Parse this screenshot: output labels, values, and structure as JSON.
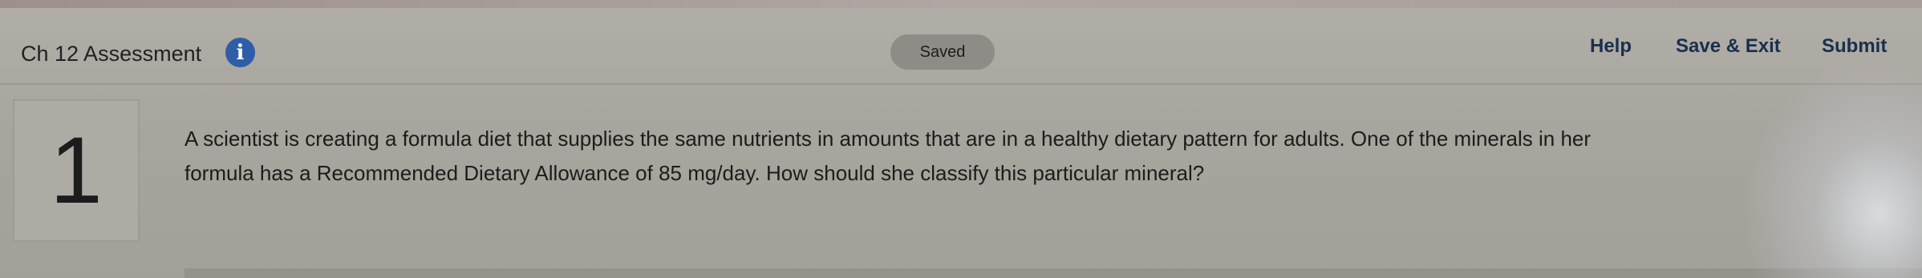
{
  "header": {
    "title": "Ch 12 Assessment",
    "info_icon": "info-icon",
    "status": "Saved",
    "nav": {
      "help": "Help",
      "save_exit": "Save & Exit",
      "submit": "Submit"
    }
  },
  "question": {
    "number": "1",
    "line1": "A scientist is creating a formula diet that supplies the same nutrients in amounts that are in a healthy dietary pattern for adults. One of the minerals in her",
    "line2": "formula has a Recommended Dietary Allowance of 85 mg/day. How should she classify this particular mineral?"
  },
  "colors": {
    "info_icon": "#2e5ea8",
    "nav_text": "#1a2f4e",
    "background": "#a9a59f"
  }
}
